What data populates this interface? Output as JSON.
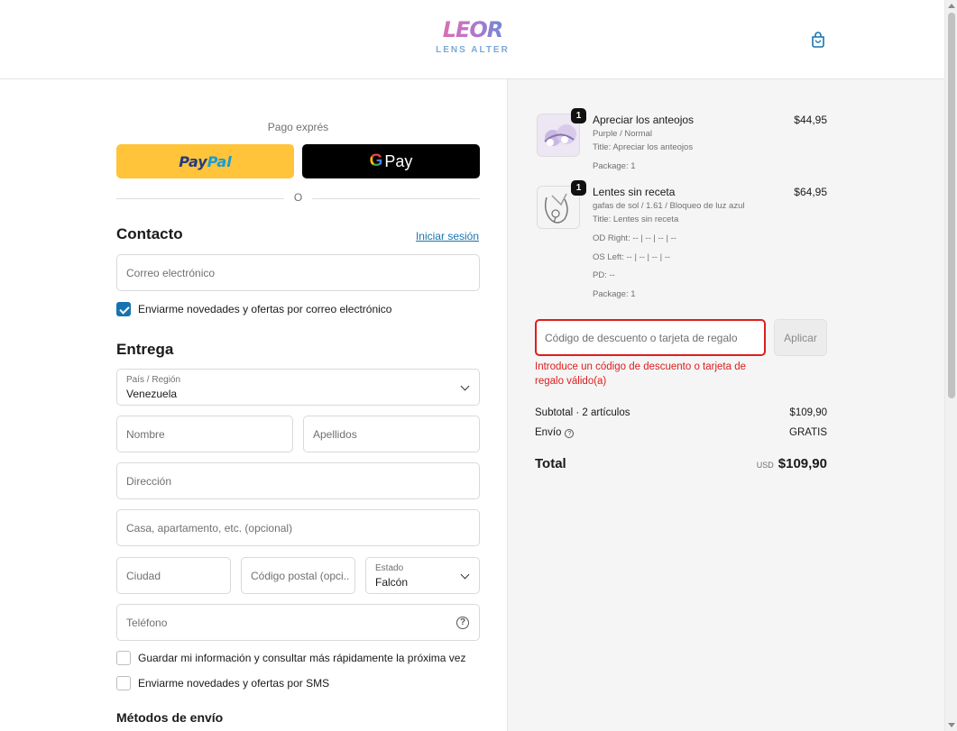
{
  "header": {
    "logo_mark": "LEOR",
    "logo_sub": "LENS ALTER"
  },
  "express": {
    "label": "Pago exprés",
    "paypal_a": "Pay",
    "paypal_b": "Pal",
    "gpay_g": "G",
    "gpay_pay": "Pay",
    "or": "O"
  },
  "contact": {
    "title": "Contacto",
    "login_link": "Iniciar sesión",
    "email_placeholder": "Correo electrónico",
    "newsletter_label": "Enviarme novedades y ofertas por correo electrónico",
    "newsletter_checked": true
  },
  "delivery": {
    "title": "Entrega",
    "country_label": "País / Región",
    "country_value": "Venezuela",
    "first_name_placeholder": "Nombre",
    "last_name_placeholder": "Apellidos",
    "address_placeholder": "Dirección",
    "apartment_placeholder": "Casa, apartamento, etc. (opcional)",
    "city_placeholder": "Ciudad",
    "postal_placeholder": "Código postal (opci...",
    "state_label": "Estado",
    "state_value": "Falcón",
    "phone_placeholder": "Teléfono",
    "save_info_label": "Guardar mi información y consultar más rápidamente la próxima vez",
    "sms_label": "Enviarme novedades y ofertas por SMS",
    "shipping_methods_title": "Métodos de envío"
  },
  "cart": {
    "items": [
      {
        "qty": "1",
        "name": "Apreciar los anteojos",
        "price": "$44,95",
        "meta": [
          "Purple / Normal",
          "Title: Apreciar los anteojos",
          "Package: 1"
        ]
      },
      {
        "qty": "1",
        "name": "Lentes sin receta",
        "price": "$64,95",
        "meta": [
          "gafas de sol / 1.61 / Bloqueo de luz azul",
          "Title: Lentes sin receta",
          "OD Right: -- | -- | -- | --",
          "OS Left: -- | -- | -- | --",
          "PD: --",
          "Package: 1"
        ]
      }
    ],
    "discount_placeholder": "Código de descuento o tarjeta de regalo",
    "apply_label": "Aplicar",
    "discount_error": "Introduce un código de descuento o tarjeta de regalo válido(a)",
    "subtotal_label": "Subtotal · 2 artículos",
    "subtotal_value": "$109,90",
    "shipping_label": "Envío",
    "shipping_value": "GRATIS",
    "total_label": "Total",
    "total_currency": "USD",
    "total_value": "$109,90"
  },
  "colors": {
    "accent": "#1773b0",
    "error": "#dd1d1d",
    "paypal_yellow": "#ffc439"
  }
}
